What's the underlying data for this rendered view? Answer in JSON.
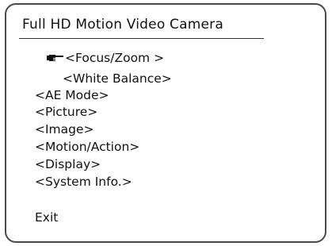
{
  "osd": {
    "title": "Full HD Motion Video Camera",
    "cursor_icon": "pointing-hand-icon",
    "menu_items": [
      {
        "label": "<Focus/Zoom >",
        "selected": true
      },
      {
        "label": "<White Balance>"
      },
      {
        "label": "<AE Mode>"
      },
      {
        "label": "<Picture>"
      },
      {
        "label": "<Image>"
      },
      {
        "label": "<Motion/Action>"
      },
      {
        "label": "<Display>"
      },
      {
        "label": "<System Info.>"
      }
    ],
    "exit_label": "Exit"
  }
}
